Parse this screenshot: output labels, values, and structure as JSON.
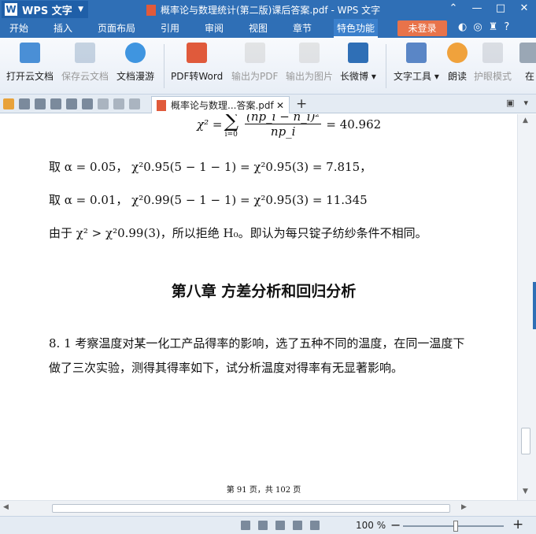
{
  "titlebar": {
    "app_name": "WPS 文字",
    "document_title": "概率论与数理统计(第二版)课后答案.pdf - WPS 文字"
  },
  "menubar": {
    "tabs": [
      "开始",
      "插入",
      "页面布局",
      "引用",
      "审阅",
      "视图",
      "章节",
      "特色功能"
    ],
    "active_tab": "特色功能",
    "login_label": "未登录"
  },
  "ribbon": {
    "buttons": [
      {
        "label": "打开云文档",
        "icon": "cloud-folder-icon",
        "enabled": true
      },
      {
        "label": "保存云文档",
        "icon": "cloud-save-icon",
        "enabled": false
      },
      {
        "label": "文档漫游",
        "icon": "cloud-roam-icon",
        "enabled": true
      },
      {
        "label": "PDF转Word",
        "icon": "pdf-to-word-icon",
        "enabled": true
      },
      {
        "label": "输出为PDF",
        "icon": "export-pdf-icon",
        "enabled": false
      },
      {
        "label": "输出为图片",
        "icon": "export-image-icon",
        "enabled": false
      },
      {
        "label": "长微博",
        "icon": "weibo-icon",
        "enabled": true,
        "dropdown": true
      },
      {
        "label": "文字工具",
        "icon": "text-tools-icon",
        "enabled": true,
        "dropdown": true
      },
      {
        "label": "朗读",
        "icon": "read-aloud-icon",
        "enabled": true
      },
      {
        "label": "护眼模式",
        "icon": "eye-care-icon",
        "enabled": false
      },
      {
        "label": "在",
        "icon": "more-icon",
        "enabled": true
      }
    ]
  },
  "tabstrip": {
    "doc_tab_label": "概率论与数理...答案.pdf",
    "new_tab_symbol": "+"
  },
  "document": {
    "formula_top": {
      "lhs": "χ² = ",
      "sum_sub": "i=0",
      "num": "(np_i − n_i)²",
      "den": "np_i",
      "rhs": "= 40.962"
    },
    "line1": "取 α = 0.05， χ²0.95(5 − 1 − 1) = χ²0.95(3) = 7.815，",
    "line2": "取  α = 0.01， χ²0.99(5 − 1 − 1) = χ²0.95(3) = 11.345",
    "line3": "由于 χ² > χ²0.99(3)，所以拒绝 H₀。即认为每只锭子纺纱条件不相同。",
    "chapter_title": "第八章  方差分析和回归分析",
    "problem_line1": "8. 1  考察温度对某一化工产品得率的影响，选了五种不同的温度，在同一温度下",
    "problem_line2": "做了三次实验，测得其得率如下，试分析温度对得率有无显著影响。",
    "page_footer": "第 91 页，共 102 页"
  },
  "status": {
    "zoom": "100 %",
    "zoom_value": 100
  },
  "colors": {
    "title_blue": "#2f6fb6",
    "login_orange": "#e8734a",
    "pdf_red": "#e05a3b"
  }
}
